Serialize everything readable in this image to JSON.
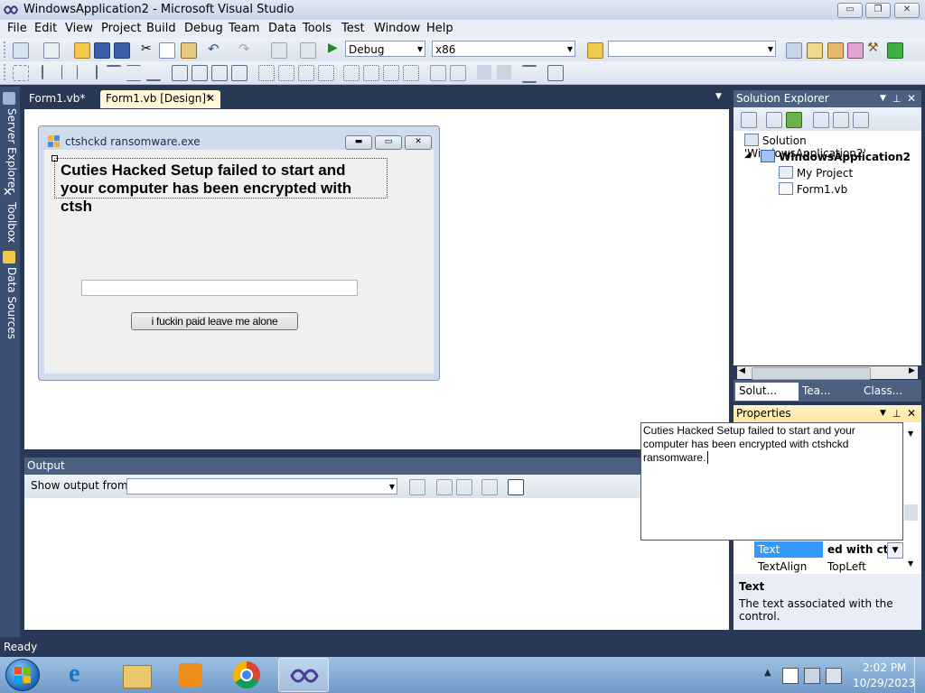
{
  "window": {
    "title": "WindowsApplication2 - Microsoft Visual Studio",
    "minimize_glyph": "▭",
    "maximize_glyph": "❐",
    "close_glyph": "✕"
  },
  "menu": [
    "File",
    "Edit",
    "View",
    "Project",
    "Build",
    "Debug",
    "Team",
    "Data",
    "Tools",
    "Test",
    "Window",
    "Help"
  ],
  "toolbar": {
    "config_value": "Debug",
    "platform_value": "x86",
    "find_value": ""
  },
  "left_strip": [
    "Server Explorer",
    "Toolbox",
    "Data Sources"
  ],
  "doc_tabs": [
    {
      "label": "Form1.vb*",
      "active": false
    },
    {
      "label": "Form1.vb [Design]*",
      "active": true
    }
  ],
  "form": {
    "title": "ctshckd ransomware.exe",
    "label_text": "Cuties Hacked Setup failed to start and your computer has been encrypted with ctsh",
    "textbox_value": "",
    "button_text": "i fuckin paid leave me alone"
  },
  "output": {
    "title": "Output",
    "show_from_label": "Show output from:",
    "source_value": ""
  },
  "solution_explorer": {
    "title": "Solution Explorer",
    "items": [
      {
        "label": "Solution 'WindowsApplication2'",
        "bold": false
      },
      {
        "label": "WindowsApplication2",
        "bold": true
      },
      {
        "label": "My Project",
        "bold": false
      },
      {
        "label": "Form1.vb",
        "bold": false
      }
    ],
    "bottom_tabs": [
      "Solut...",
      "Tea...",
      "Class..."
    ]
  },
  "properties": {
    "title": "Properties",
    "text_editor_value": "Cuties Hacked Setup failed to start and your computer has been encrypted with ctshckd ransomware.",
    "rows": [
      {
        "name": "Text",
        "value": "ed with ctsh",
        "selected": true
      },
      {
        "name": "TextAlign",
        "value": "TopLeft",
        "selected": false
      }
    ],
    "desc_title": "Text",
    "desc_body": "The text associated with the control."
  },
  "status": {
    "text": "Ready"
  },
  "taskbar": {
    "time": "2:02 PM",
    "date": "10/29/2023"
  },
  "colors": {
    "vs_frame": "#293955",
    "panel_title": "#4d6082",
    "selected_prop": "#3399ff"
  }
}
